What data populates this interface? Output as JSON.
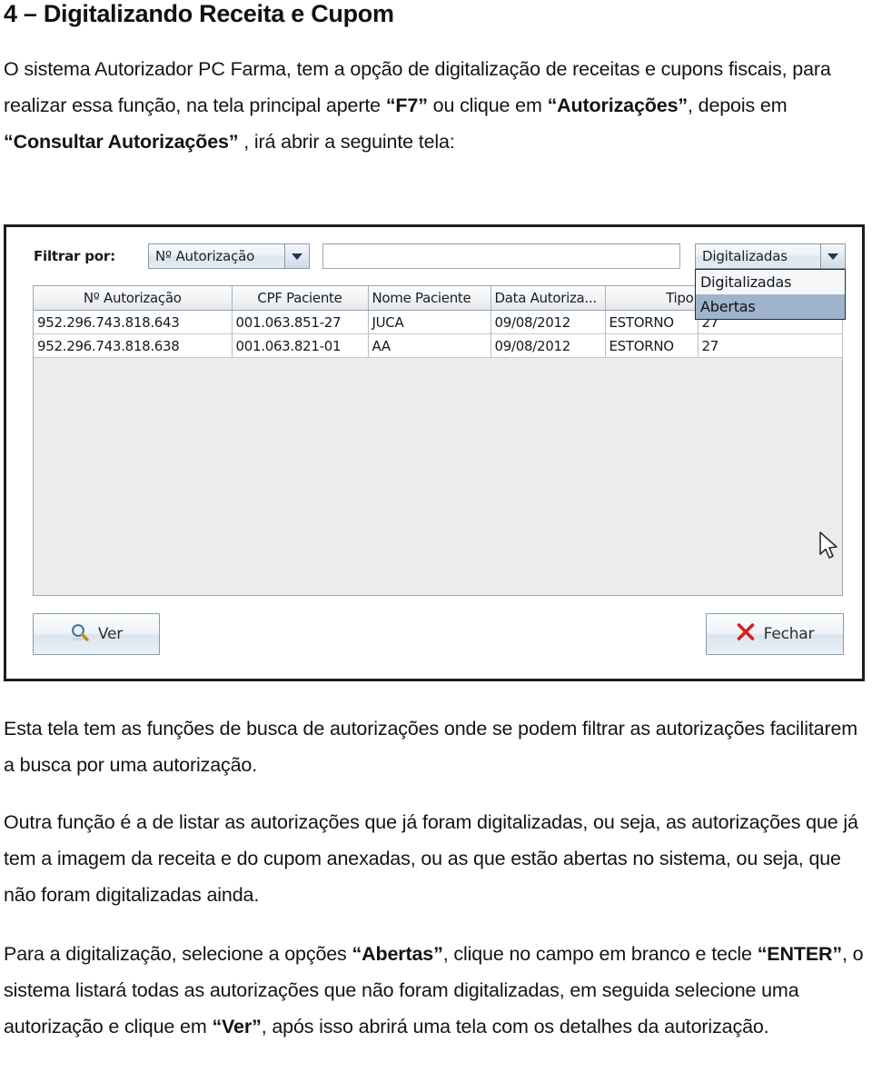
{
  "document": {
    "heading": "4 – Digitalizando Receita e Cupom",
    "paragraphs": {
      "intro": {
        "p1": "O sistema Autorizador PC Farma, tem a opção de digitalização de receitas e cupons fiscais, para realizar essa função, na tela principal aperte ",
        "b1": "“F7”",
        "p2": " ou clique em ",
        "b2": "“Autorizações”",
        "p3": ", depois em ",
        "b3": "“Consultar Autorizações”",
        "p4": " , irá abrir a seguinte tela:"
      },
      "after1": "Esta tela tem as funções de busca de autorizações onde se podem filtrar as autorizações facilitarem a busca por uma autorização.",
      "after2": "Outra função é a de listar as autorizações que já foram digitalizadas, ou seja, as autorizações que já tem a imagem da receita e do cupom anexadas, ou as que estão abertas no sistema, ou seja, que não foram digitalizadas ainda.",
      "after3": {
        "p1": "Para a digitalização, selecione a opções ",
        "b1": "“Abertas”",
        "p2": ", clique no campo em branco e tecle ",
        "b2": "“ENTER”",
        "p3": ", o sistema listará todas as autorizações que não foram digitalizadas, em seguida selecione uma autorização e clique em ",
        "b3": "“Ver”",
        "p4": ", após isso abrirá uma tela com os detalhes da autorização."
      }
    }
  },
  "app": {
    "filter": {
      "label": "Filtrar por:",
      "field_combo_value": "Nº Autorização",
      "search_value": "",
      "search_placeholder": "",
      "status_combo_value": "Digitalizadas",
      "status_options": [
        "Digitalizadas",
        "Abertas"
      ],
      "status_selected_option": "Abertas"
    },
    "grid": {
      "columns": [
        {
          "label": "Nº Autorização",
          "align": "ta-center"
        },
        {
          "label": "CPF Paciente",
          "align": "ta-center"
        },
        {
          "label": "Nome Paciente",
          "align": "ta-left"
        },
        {
          "label": "Data Autoriza...",
          "align": "ta-left"
        },
        {
          "label": "Tipo",
          "align": "ta-right"
        },
        {
          "label": "",
          "align": "ta-left"
        }
      ],
      "rows": [
        [
          "952.296.743.818.643",
          "001.063.851-27",
          "JUCA",
          "09/08/2012",
          "ESTORNO",
          "27"
        ],
        [
          "952.296.743.818.638",
          "001.063.821-01",
          "AA",
          "09/08/2012",
          "ESTORNO",
          "27"
        ]
      ]
    },
    "buttons": {
      "ver": "Ver",
      "fechar": "Fechar"
    }
  },
  "colors": {
    "dropdown_highlight": "#9fb4cb",
    "window_border": "#1c1c1c",
    "grid_empty_bg": "#ececec",
    "close_x": "#cc2222"
  }
}
